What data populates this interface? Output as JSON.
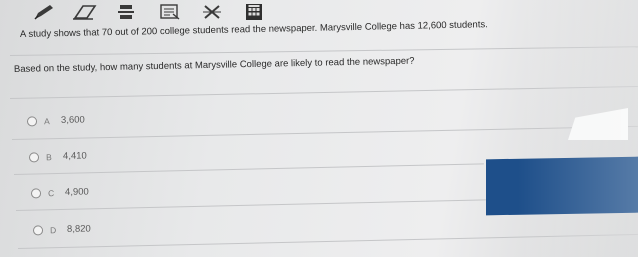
{
  "toolbar": {
    "icons": [
      "pencil-icon",
      "eraser-icon",
      "fraction-icon",
      "notes-icon",
      "eliminate-icon",
      "calculator-icon"
    ]
  },
  "question": {
    "line1": "A study shows that 70 out of 200 college students read the newspaper. Marysville College has 12,600 students.",
    "line2": "Based on the study, how many students at Marysville College are likely to read the newspaper?"
  },
  "choices": [
    {
      "letter": "A",
      "value": "3,600"
    },
    {
      "letter": "B",
      "value": "4,410"
    },
    {
      "letter": "C",
      "value": "4,900"
    },
    {
      "letter": "D",
      "value": "8,820"
    }
  ],
  "colors": {
    "accent_blue": "#1e4f8a",
    "background": "#e8e9ea"
  }
}
